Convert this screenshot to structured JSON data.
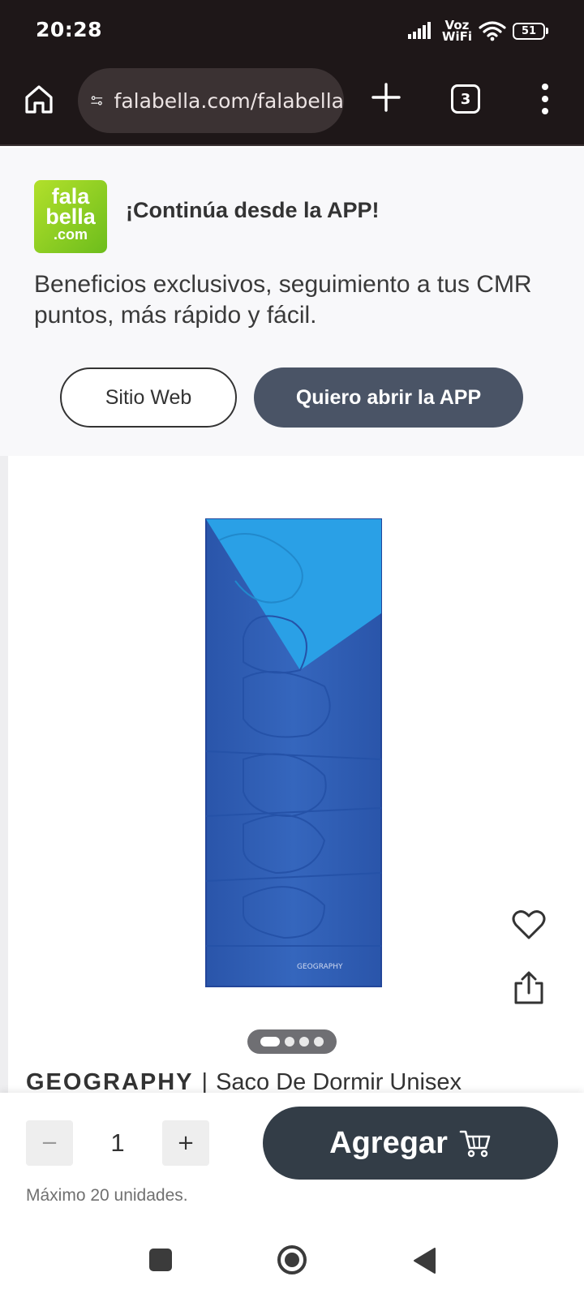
{
  "status_bar": {
    "time": "20:28",
    "network_label_1": "Voz",
    "network_label_2": "WiFi",
    "battery": "51"
  },
  "browser": {
    "url": "falabella.com/falabella",
    "tab_count": "3"
  },
  "app_banner": {
    "logo_line1": "fala",
    "logo_line2": "bella",
    "logo_line3": ".com",
    "title": "¡Continúa desde la APP!",
    "description": "Beneficios exclusivos, seguimiento a tus CMR puntos, más rápido y fácil.",
    "web_button": "Sitio Web",
    "app_button": "Quiero abrir la APP"
  },
  "product": {
    "image_label": "GEOGRAPHY",
    "image_count": 4,
    "active_image": 1,
    "brand": "GEOGRAPHY",
    "separator": "|",
    "name": "Saco De Dormir Unisex"
  },
  "purchase": {
    "minus_label": "−",
    "quantity": "1",
    "plus_label": "+",
    "max_note": "Máximo 20 unidades.",
    "add_button": "Agregar"
  },
  "colors": {
    "dark_bar": "#1e1718",
    "app_button": "#4a5466",
    "add_button": "#333d47",
    "logo_green": "#8ccf22"
  }
}
